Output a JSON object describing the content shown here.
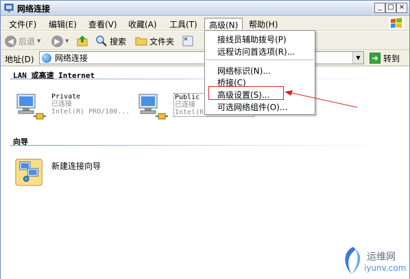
{
  "window": {
    "title": "网络连接"
  },
  "titlebar": {
    "min": "_",
    "max": "□",
    "close": "×"
  },
  "menu": {
    "items": [
      {
        "label": "文件(F)"
      },
      {
        "label": "编辑(E)"
      },
      {
        "label": "查看(V)"
      },
      {
        "label": "收藏(A)"
      },
      {
        "label": "工具(T)"
      },
      {
        "label": "高级(N)"
      },
      {
        "label": "帮助(H)"
      }
    ]
  },
  "toolbar": {
    "back": "后退",
    "search": "搜索",
    "folders": "文件夹"
  },
  "address": {
    "label": "地址(D)",
    "value": "网络连接",
    "go": "转到"
  },
  "groups": [
    {
      "header": "LAN 或高速 Internet",
      "connections": [
        {
          "name": "Private",
          "status": "已连接",
          "device": "Intel(R) PRO/100..."
        },
        {
          "name": "Public",
          "status": "已连接",
          "device": "Intel(R) PRO/100..."
        }
      ]
    },
    {
      "header": "向导",
      "connections": [
        {
          "name": "新建连接向导"
        }
      ]
    }
  ],
  "dropdown": {
    "items": [
      {
        "label": "接线员辅助拨号(P)"
      },
      {
        "label": "远程访问首选项(R)..."
      },
      {
        "label": "网络标识(N)..."
      },
      {
        "label": "桥接(C)"
      },
      {
        "label": "高级设置(S)..."
      },
      {
        "label": "可选网络组件(O)..."
      }
    ]
  },
  "watermark": {
    "text1": "运维网",
    "text2": "iyunv.com"
  },
  "colors": {
    "annotation_red": "#e11e1e",
    "title_bg": "#dbe4f3"
  }
}
